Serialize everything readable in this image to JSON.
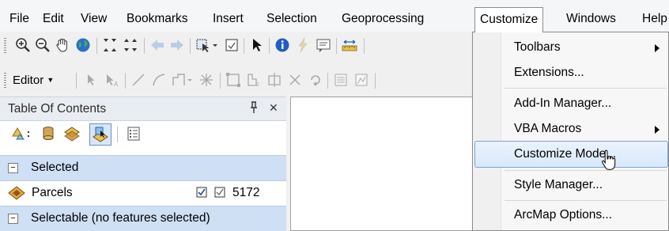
{
  "menubar": {
    "items": [
      "File",
      "Edit",
      "View",
      "Bookmarks",
      "Insert",
      "Selection",
      "Geoprocessing",
      "Customize",
      "Windows",
      "Help"
    ],
    "open_item": "Customize"
  },
  "editor_toolbar": {
    "label": "Editor"
  },
  "toc": {
    "title": "Table Of Contents",
    "pin_glyph": "ᵖ",
    "close_glyph": "✕",
    "groups": {
      "selected": {
        "label": "Selected"
      },
      "selectable": {
        "label": "Selectable (no features selected)"
      }
    },
    "layer": {
      "name": "Parcels",
      "count": "5172"
    }
  },
  "customize_menu": {
    "items": [
      {
        "label": "Toolbars",
        "submenu": true
      },
      {
        "label": "Extensions...",
        "submenu": false
      },
      {
        "label": "Add-In Manager...",
        "submenu": false
      },
      {
        "label": "VBA Macros",
        "submenu": true
      },
      {
        "label": "Customize Mode...",
        "submenu": false,
        "highlighted": true
      },
      {
        "label": "Style Manager...",
        "submenu": false
      },
      {
        "label": "ArcMap Options...",
        "submenu": false
      }
    ]
  },
  "colors": {
    "menubar_bg": "#f5f6f7",
    "toc_title_bg": "#e9edf2",
    "group_row_bg": "#cfe0f5",
    "menu_highlight_border": "#7da2ce"
  }
}
